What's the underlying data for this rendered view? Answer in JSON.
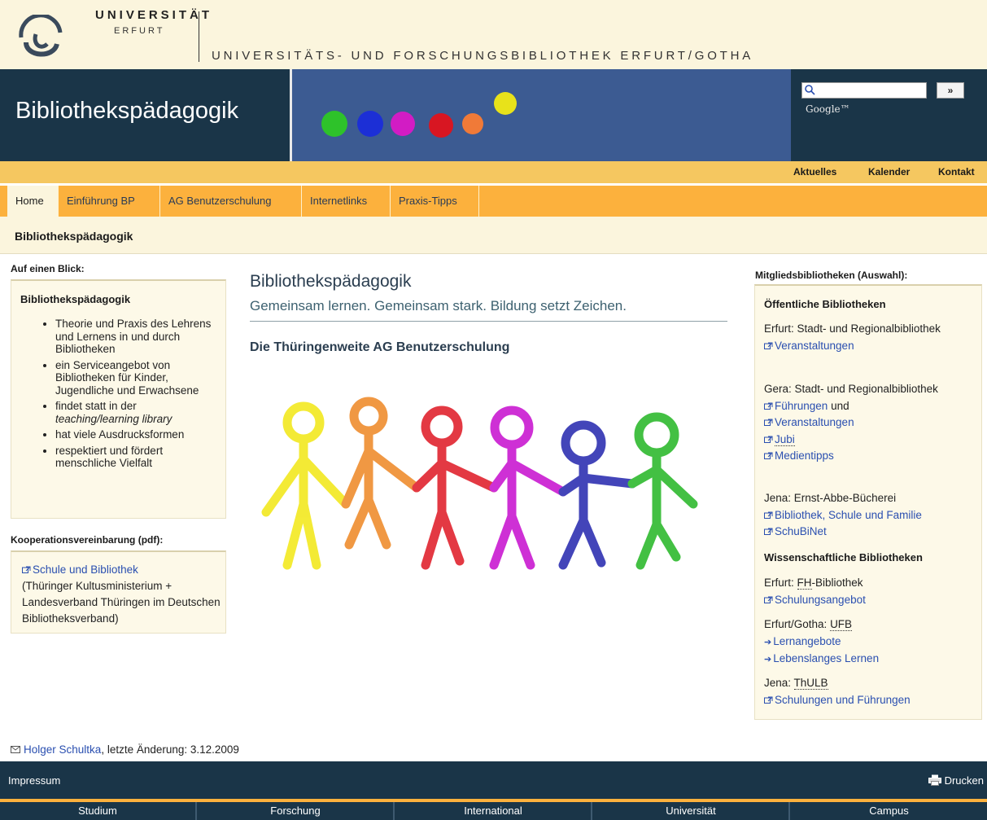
{
  "header": {
    "university_name": "UNIVERSITÄT",
    "university_city": "ERFURT",
    "library_title": "UNIVERSITÄTS- UND FORSCHUNGSBIBLIOTHEK ERFURT/GOTHA"
  },
  "banner": {
    "title": "Bibliothekspädagogik",
    "search_button": "»",
    "search_provider": "Google™",
    "dots_colors": [
      "#2ec22a",
      "#1c2fd6",
      "#d21cc4",
      "#d81622",
      "#f07a38",
      "#e8e21a"
    ]
  },
  "utility_nav": [
    "Aktuelles",
    "Kalender",
    "Kontakt"
  ],
  "main_nav": {
    "tabs": [
      "Home",
      "Einführung BP",
      "AG Benutzerschulung",
      "Internetlinks",
      "Praxis-Tipps"
    ],
    "active": "Home"
  },
  "breadcrumb": "Bibliothekspädagogik",
  "left": {
    "heading1": "Auf einen Blick:",
    "box1_title": "Bibliothekspädagogik",
    "box1_items": [
      "Theorie und Praxis des Lehrens und Lernens in und durch Bibliotheken",
      "ein Serviceangebot von Bibliotheken für Kinder, Jugendliche und Erwachsene",
      "findet statt in der",
      "teaching/learning library",
      "hat viele Ausdrucksformen",
      "respektiert und fördert menschliche Vielfalt"
    ],
    "heading2": "Kooperationsvereinbarung (pdf):",
    "box2_link": "Schule und Bibliothek",
    "box2_text": "(Thüringer Kultusministerium + Landesverband Thüringen im Deutschen Bibliotheksverband)"
  },
  "center": {
    "title": "Bibliothekspädagogik",
    "subtitle": "Gemeinsam lernen. Gemeinsam stark. Bildung setzt Zeichen.",
    "heading": "Die Thüringenweite AG Benutzerschulung",
    "figure_colors": [
      "#f2e81a",
      "#ee8a2a",
      "#e01e2a",
      "#c814d0",
      "#2a2cb0",
      "#2ab82a"
    ]
  },
  "right": {
    "heading": "Mitgliedsbibliotheken (Auswahl):",
    "public_heading": "Öffentliche Bibliotheken",
    "erfurt_name": "Erfurt: Stadt- und Regionalbibliothek",
    "erfurt_link": "Veranstaltungen",
    "gera_name": "Gera: Stadt- und Regionalbibliothek",
    "gera_link1": "Führungen",
    "gera_und": "und",
    "gera_link2": "Veranstaltungen",
    "gera_link3": "Jubi",
    "gera_link4": "Medientipps",
    "jena_name": "Jena: Ernst-Abbe-Bücherei",
    "jena_link1": "Bibliothek, Schule und Familie",
    "jena_link2": "SchuBiNet",
    "academic_heading": "Wissenschaftliche Bibliotheken",
    "fh_prefix": "Erfurt:",
    "fh_abbr": "FH",
    "fh_suffix": "-Bibliothek",
    "fh_link": "Schulungsangebot",
    "ufb_prefix": "Erfurt/Gotha:",
    "ufb_abbr": "UFB",
    "ufb_link1": "Lernangebote",
    "ufb_link2": "Lebenslanges Lernen",
    "thulb_prefix": "Jena:",
    "thulb_abbr": "ThULB",
    "thulb_link": "Schulungen und Führungen"
  },
  "footer": {
    "author": "Holger Schultka",
    "last_change": ", letzte Änderung: 3.12.2009",
    "impressum": "Impressum",
    "print": "Drucken",
    "bottom_nav": [
      "Studium",
      "Forschung",
      "International",
      "Universität",
      "Campus"
    ]
  }
}
